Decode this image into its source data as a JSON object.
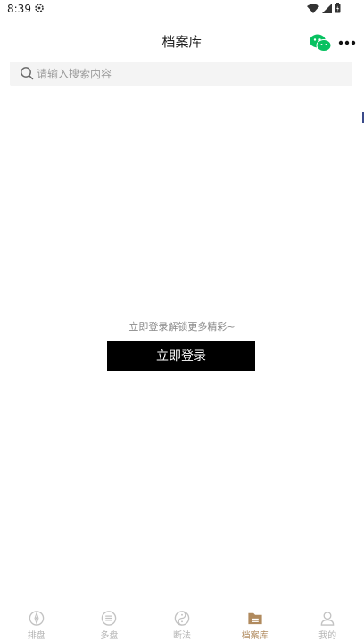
{
  "status_bar": {
    "time": "8:39"
  },
  "header": {
    "title": "档案库"
  },
  "search": {
    "placeholder": "请输入搜索内容",
    "value": ""
  },
  "empty_state": {
    "hint": "立即登录解锁更多精彩~",
    "button_label": "立即登录"
  },
  "tabs": [
    {
      "label": "排盘",
      "icon": "compass-icon"
    },
    {
      "label": "多盘",
      "icon": "list-icon"
    },
    {
      "label": "断法",
      "icon": "yinyang-icon"
    },
    {
      "label": "档案库",
      "icon": "folder-icon",
      "active": true
    },
    {
      "label": "我的",
      "icon": "user-icon"
    }
  ],
  "colors": {
    "active_tab": "#b08a5e",
    "inactive_tab": "#b5b5b5",
    "wechat": "#07c160",
    "button_bg": "#000000"
  }
}
